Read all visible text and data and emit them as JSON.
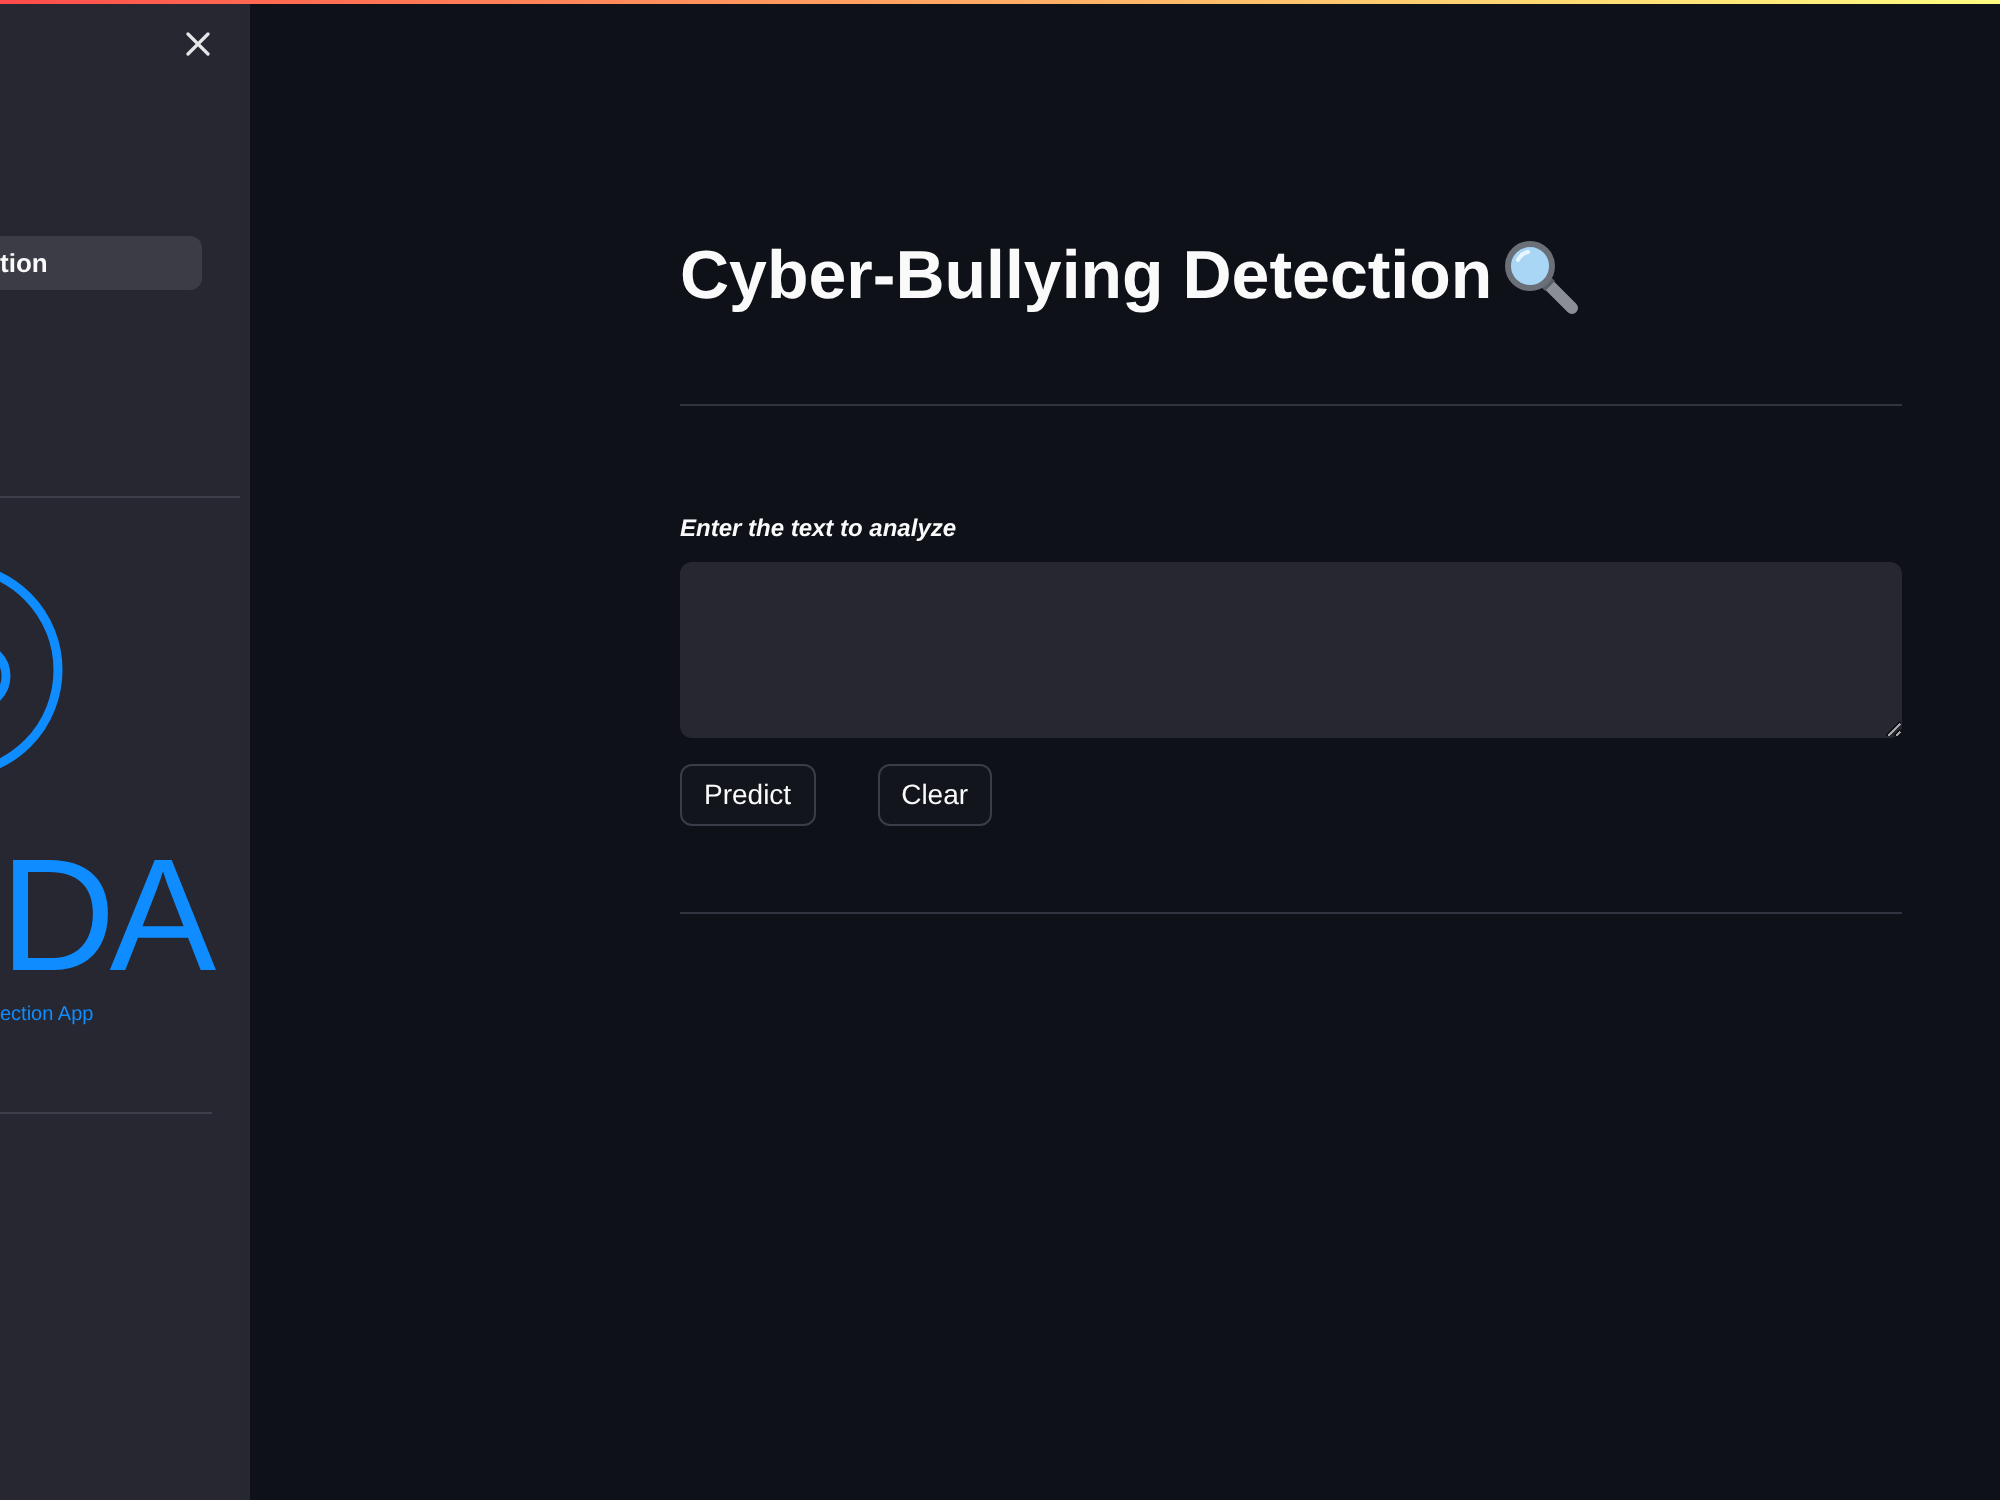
{
  "sidebar": {
    "nav_items": [
      {
        "label": "tion",
        "selected": true
      }
    ],
    "logo": {
      "wordmark": "DA",
      "tagline": "ection App"
    }
  },
  "main": {
    "title": "Cyber-Bullying Detection",
    "text_area": {
      "label": "Enter the text to analyze"
    },
    "buttons": [
      "Predict",
      "Clear"
    ]
  }
}
